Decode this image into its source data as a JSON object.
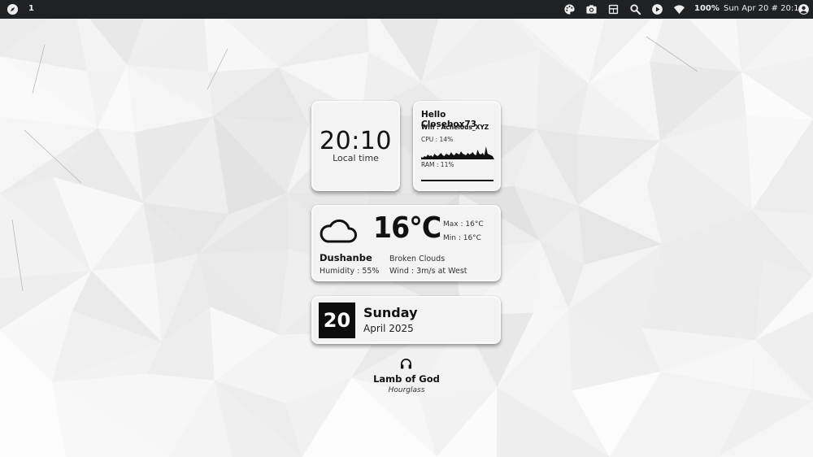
{
  "topbar": {
    "workspace": "1",
    "battery": "100%",
    "datetime": "Sun Apr 20 # 20:10",
    "icons": [
      "compass-icon",
      "palette-icon",
      "camera-icon",
      "layout-icon",
      "search-icon",
      "play-icon",
      "wifi-icon",
      "user-icon"
    ]
  },
  "clock_widget": {
    "time": "20:10",
    "subtitle": "Local time"
  },
  "system_widget": {
    "greeting": "Hello Closebox73",
    "wifi": "Wifi : Achelous_XYZ",
    "cpu": "CPU : 14%",
    "ram": "RAM : 11%",
    "ram_fraction": 0.11
  },
  "weather_widget": {
    "icon": "cloud-icon",
    "temperature": "16°C",
    "max": "Max : 16°C",
    "min": "Min : 16°C",
    "city": "Dushanbe",
    "description": "Broken Clouds",
    "humidity": "Humidity : 55%",
    "wind": "Wind : 3m/s at West"
  },
  "date_widget": {
    "day_number": "20",
    "weekday": "Sunday",
    "month_year": "April 2025"
  },
  "music_widget": {
    "icon": "headphones-icon",
    "artist": "Lamb of God",
    "title": "Hourglass"
  },
  "colors": {
    "topbar_bg": "#1f2124",
    "card_bg": "#f3f3f3",
    "accent": "#111111"
  }
}
